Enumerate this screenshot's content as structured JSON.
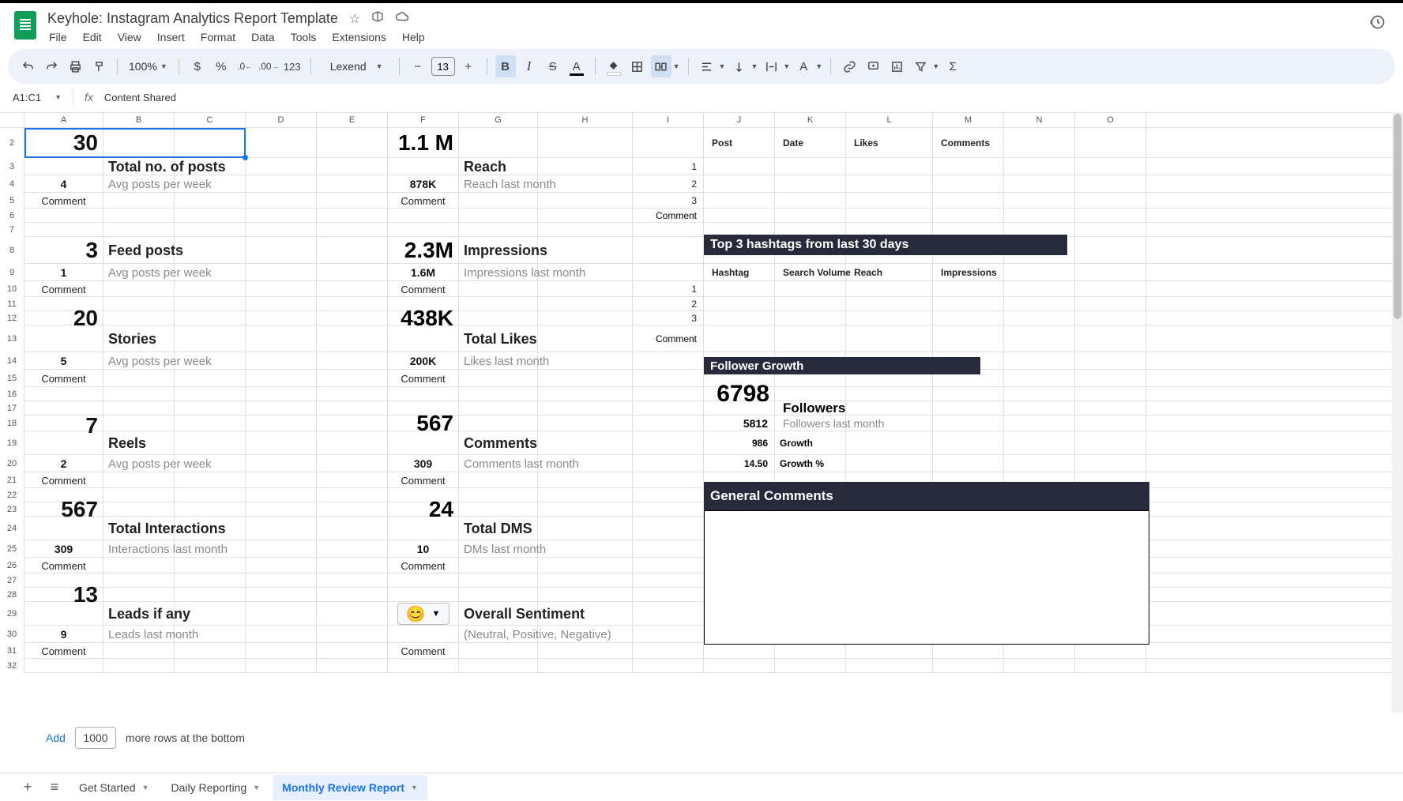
{
  "doc": {
    "title": "Keyhole: Instagram Analytics Report Template"
  },
  "menu": {
    "file": "File",
    "edit": "Edit",
    "view": "View",
    "insert": "Insert",
    "format": "Format",
    "data": "Data",
    "tools": "Tools",
    "extensions": "Extensions",
    "help": "Help"
  },
  "toolbar": {
    "zoom": "100%",
    "font": "Lexend",
    "size": "13",
    "fmt123": "123"
  },
  "namebox": {
    "ref": "A1:C1",
    "formula": "Content Shared"
  },
  "cols": [
    "A",
    "B",
    "C",
    "D",
    "E",
    "F",
    "G",
    "H",
    "I",
    "J",
    "K",
    "L",
    "M",
    "N",
    "O"
  ],
  "rownums": [
    "2",
    "3",
    "4",
    "5",
    "6",
    "7",
    "8",
    "9",
    "10",
    "11",
    "12",
    "13",
    "14",
    "15",
    "16",
    "17",
    "18",
    "19",
    "20",
    "21",
    "22",
    "23",
    "24",
    "25",
    "26",
    "27",
    "28",
    "29",
    "30",
    "31",
    "32"
  ],
  "left": [
    {
      "big": "30",
      "label": "Total no. of posts",
      "mid": "4",
      "sub": "Avg posts per week",
      "comment": "Comment"
    },
    {
      "big": "3",
      "label": "Feed posts",
      "mid": "1",
      "sub": "Avg posts per week",
      "comment": "Comment"
    },
    {
      "big": "20",
      "label": "Stories",
      "mid": "5",
      "sub": "Avg posts per week",
      "comment": "Comment"
    },
    {
      "big": "7",
      "label": "Reels",
      "mid": "2",
      "sub": "Avg posts per week",
      "comment": "Comment"
    },
    {
      "big": "567",
      "label": "Total Interactions",
      "mid": "309",
      "sub": "Interactions last month",
      "comment": "Comment"
    },
    {
      "big": "13",
      "label": "Leads if any",
      "mid": "9",
      "sub": "Leads last month",
      "comment": "Comment"
    }
  ],
  "mid": [
    {
      "big": "1.1 M",
      "label": "Reach",
      "mid": "878K",
      "sub": "Reach last month",
      "comment": "Comment"
    },
    {
      "big": "2.3M",
      "label": "Impressions",
      "mid": "1.6M",
      "sub": "Impressions last month",
      "comment": "Comment"
    },
    {
      "big": "438K",
      "label": "Total Likes",
      "mid": "200K",
      "sub": "Likes last month",
      "comment": "Comment"
    },
    {
      "big": "567",
      "label": "Comments",
      "mid": "309",
      "sub": "Comments last month",
      "comment": "Comment"
    },
    {
      "big": "24",
      "label": "Total DMS",
      "mid": "10",
      "sub": "DMs last month",
      "comment": "Comment"
    },
    {
      "big": "",
      "label": "Overall Sentiment",
      "mid": "",
      "sub": "(Neutral, Positive, Negative)",
      "comment": "Comment",
      "sentiment": true
    }
  ],
  "right": {
    "postHead": {
      "post": "Post",
      "date": "Date",
      "likes": "Likes",
      "comments": "Comments"
    },
    "postNums": [
      "1",
      "2",
      "3"
    ],
    "postComment": "Comment",
    "hashHead": "Top 3 hashtags from last 30 days",
    "hashCols": {
      "hashtag": "Hashtag",
      "sv": "Search Volume",
      "reach": "Reach",
      "impr": "Impressions"
    },
    "hashNums": [
      "1",
      "2",
      "3"
    ],
    "hashComment": "Comment",
    "fgHead": "Follower Growth",
    "fg": {
      "v1": "6798",
      "l1": "Followers",
      "v2": "5812",
      "l2": "Followers last month",
      "v3": "986",
      "l3": "Growth",
      "v4": "14.50",
      "l4": "Growth %"
    },
    "gcHead": "General Comments"
  },
  "footer": {
    "add": "Add",
    "rows": "1000",
    "more": "more rows at the bottom"
  },
  "tabs": {
    "t1": "Get Started",
    "t2": "Daily Reporting",
    "t3": "Monthly Review Report"
  }
}
